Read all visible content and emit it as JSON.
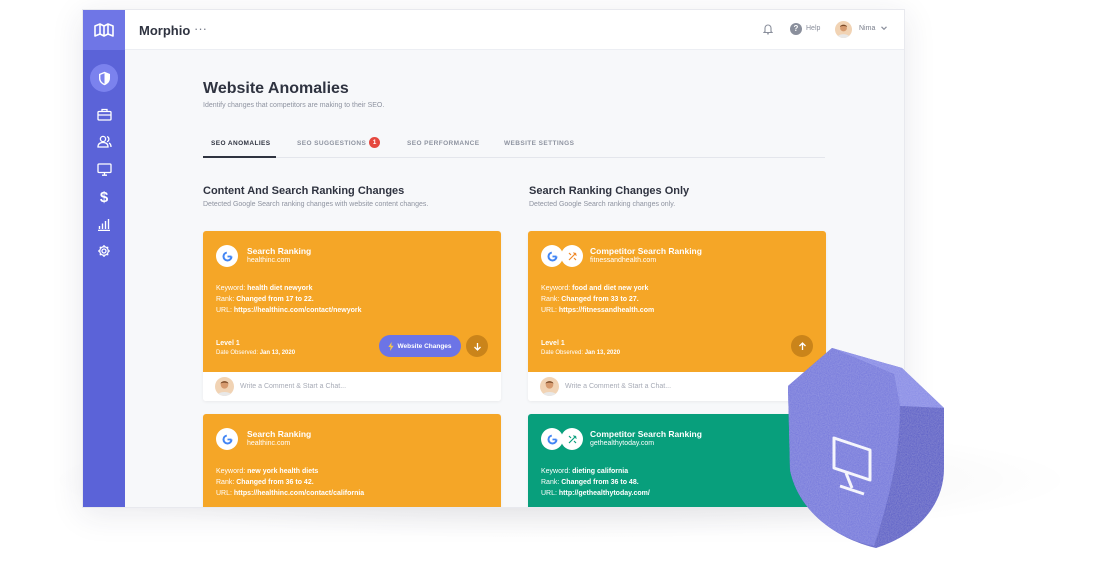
{
  "app": {
    "brand": "Morphio",
    "brand_more": "···",
    "help_label": "Help",
    "user_name": "Nima"
  },
  "sidebar": {
    "items": [
      {
        "icon": "shield-icon",
        "active": true
      },
      {
        "icon": "briefcase-icon"
      },
      {
        "icon": "users-icon"
      },
      {
        "icon": "monitor-icon"
      },
      {
        "icon": "dollar-icon",
        "glyph": "$"
      },
      {
        "icon": "bar-chart-icon"
      },
      {
        "icon": "gear-icon"
      }
    ]
  },
  "page": {
    "title": "Website Anomalies",
    "subtitle": "Identify changes that competitors are making to their SEO."
  },
  "tabs": [
    {
      "label": "SEO ANOMALIES",
      "active": true
    },
    {
      "label": "SEO SUGGESTIONS",
      "badge": "1"
    },
    {
      "label": "SEO PERFORMANCE"
    },
    {
      "label": "WEBSITE SETTINGS"
    }
  ],
  "columns": [
    {
      "title": "Content And Search Ranking Changes",
      "subtitle": "Detected Google Search ranking changes with website content changes."
    },
    {
      "title": "Search Ranking Changes Only",
      "subtitle": "Detected Google Search ranking changes only."
    }
  ],
  "labels": {
    "keyword": "Keyword:",
    "rank": "Rank:",
    "url": "URL:",
    "date_observed": "Date Observed:",
    "website_changes": "Website Changes",
    "comment_placeholder": "Write a Comment & Start a Chat..."
  },
  "cards": [
    {
      "title": "Search Ranking",
      "domain": "healthinc.com",
      "keyword": "health diet newyork",
      "rank": "Changed from 17 to 22.",
      "url": "https://healthinc.com/contact/newyork",
      "level": "Level 1",
      "date": "Jan 13, 2020",
      "color": "#f5a627"
    },
    {
      "title": "Competitor Search Ranking",
      "domain": "fitnessandhealth.com",
      "keyword": "food and diet new york",
      "rank": "Changed from 33 to 27.",
      "url": "https://fitnessandhealth.com",
      "level": "Level 1",
      "date": "Jan 13, 2020",
      "color": "#f5a627"
    },
    {
      "title": "Search Ranking",
      "domain": "healthinc.com",
      "keyword": "new york health diets",
      "rank": "Changed from 36 to 42.",
      "url": "https://healthinc.com/contact/california",
      "color": "#f5a627"
    },
    {
      "title": "Competitor Search Ranking",
      "domain": "gethealthytoday.com",
      "keyword": "dieting california",
      "rank": "Changed from 36 to 48.",
      "url": "http://gethealthytoday.com/",
      "color": "#089f7c"
    }
  ],
  "colors": {
    "sidebar": "#5b63d8",
    "accent": "#6c74e6",
    "orange": "#f5a627",
    "green": "#089f7c",
    "shield": "#6d71d8"
  }
}
